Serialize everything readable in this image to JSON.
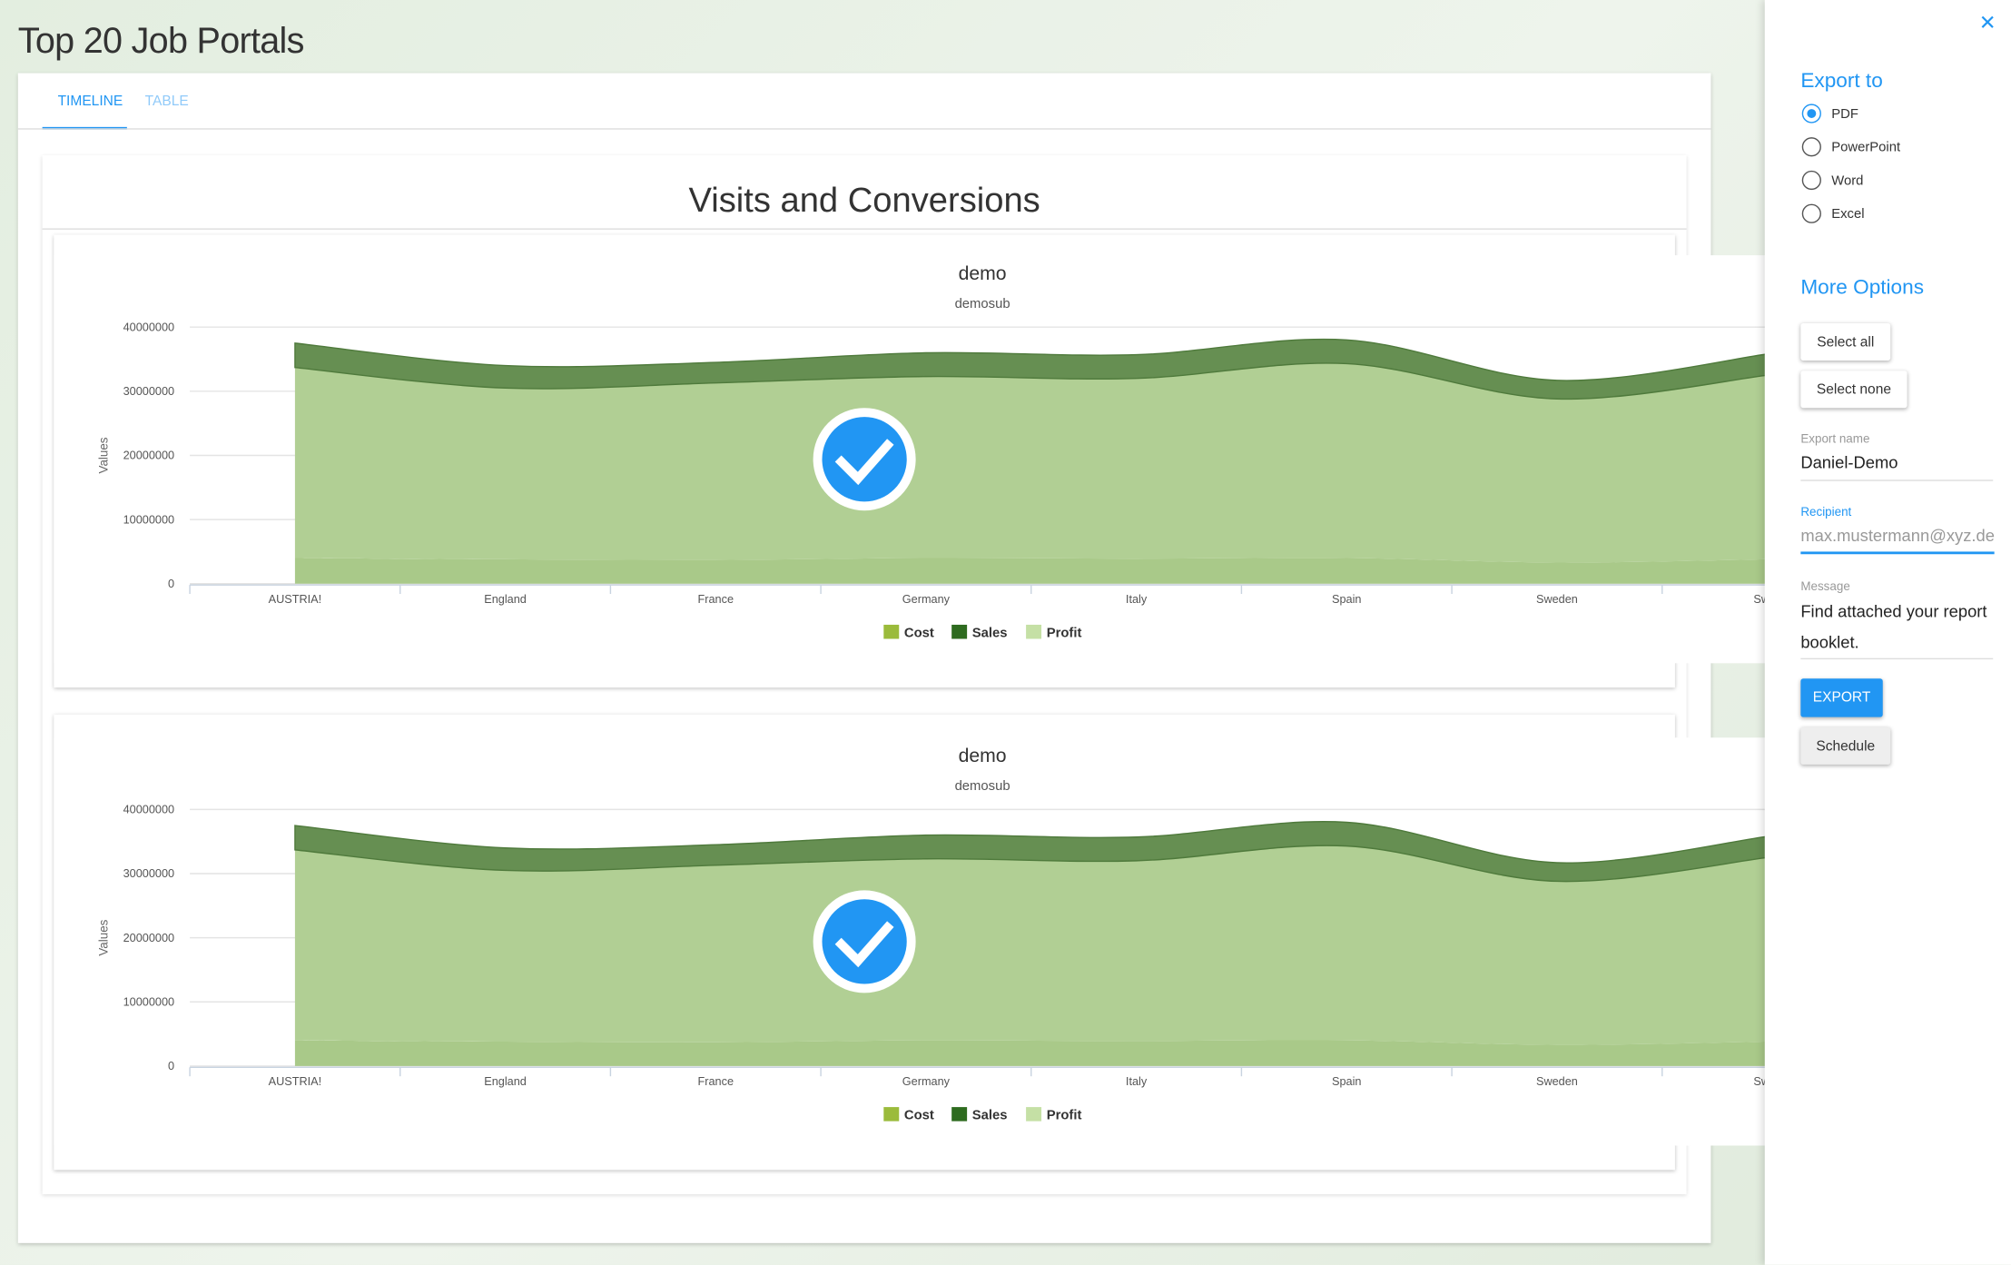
{
  "page": {
    "title": "Top 20 Job Portals"
  },
  "tabs": [
    {
      "label": "TIMELINE",
      "active": true
    },
    {
      "label": "TABLE",
      "active": false
    }
  ],
  "report": {
    "title": "Visits and Conversions"
  },
  "colors": {
    "accent": "#2196f3",
    "cost": "#9bbb3b",
    "sales": "#2e6b1f",
    "profit": "#c5e0a5"
  },
  "chart_data": [
    {
      "type": "area",
      "stacked": true,
      "title": "demo",
      "subtitle": "demosub",
      "xlabel": "",
      "ylabel": "Values",
      "ylim": [
        0,
        40000000
      ],
      "yticks": [
        "0",
        "10000000",
        "20000000",
        "30000000",
        "40000000"
      ],
      "grid": true,
      "legend_position": "bottom",
      "categories": [
        "AUSTRIA!",
        "England",
        "France",
        "Germany",
        "Italy",
        "Spain",
        "Sweden",
        "Switz"
      ],
      "series": [
        {
          "name": "Cost",
          "values": [
            4000000,
            3800000,
            3700000,
            4000000,
            3900000,
            4000000,
            3300000,
            3800000
          ]
        },
        {
          "name": "Profit",
          "values": [
            29700000,
            26700000,
            27600000,
            28300000,
            28100000,
            30300000,
            25500000,
            28700000
          ]
        },
        {
          "name": "Sales",
          "values": [
            3800000,
            3500000,
            3200000,
            3700000,
            3700000,
            3700000,
            2900000,
            3300000
          ]
        }
      ],
      "legend": [
        "Cost",
        "Sales",
        "Profit"
      ],
      "overlay_icon": "check-circle-icon"
    },
    {
      "type": "area",
      "stacked": true,
      "title": "demo",
      "subtitle": "demosub",
      "xlabel": "",
      "ylabel": "Values",
      "ylim": [
        0,
        40000000
      ],
      "yticks": [
        "0",
        "10000000",
        "20000000",
        "30000000",
        "40000000"
      ],
      "grid": true,
      "legend_position": "bottom",
      "categories": [
        "AUSTRIA!",
        "England",
        "France",
        "Germany",
        "Italy",
        "Spain",
        "Sweden",
        "Switz"
      ],
      "series": [
        {
          "name": "Cost",
          "values": [
            4000000,
            3800000,
            3700000,
            4000000,
            3900000,
            4000000,
            3300000,
            3800000
          ]
        },
        {
          "name": "Profit",
          "values": [
            29700000,
            26700000,
            27600000,
            28300000,
            28100000,
            30300000,
            25500000,
            28700000
          ]
        },
        {
          "name": "Sales",
          "values": [
            3800000,
            3500000,
            3200000,
            3700000,
            3700000,
            3700000,
            2900000,
            3300000
          ]
        }
      ],
      "legend": [
        "Cost",
        "Sales",
        "Profit"
      ],
      "overlay_icon": "check-circle-icon"
    }
  ],
  "panel": {
    "close_icon": "close-icon",
    "export_to": "Export to",
    "formats": [
      {
        "label": "PDF",
        "selected": true
      },
      {
        "label": "PowerPoint",
        "selected": false
      },
      {
        "label": "Word",
        "selected": false
      },
      {
        "label": "Excel",
        "selected": false
      }
    ],
    "more_options": "More Options",
    "select_all": "Select all",
    "select_none": "Select none",
    "export_name_label": "Export name",
    "export_name_value": "Daniel-Demo",
    "recipient_label": "Recipient",
    "recipient_placeholder": "max.mustermann@xyz.de",
    "message_label": "Message",
    "message_value": "Find attached your report booklet.",
    "export_button": "EXPORT",
    "schedule_button": "Schedule"
  }
}
